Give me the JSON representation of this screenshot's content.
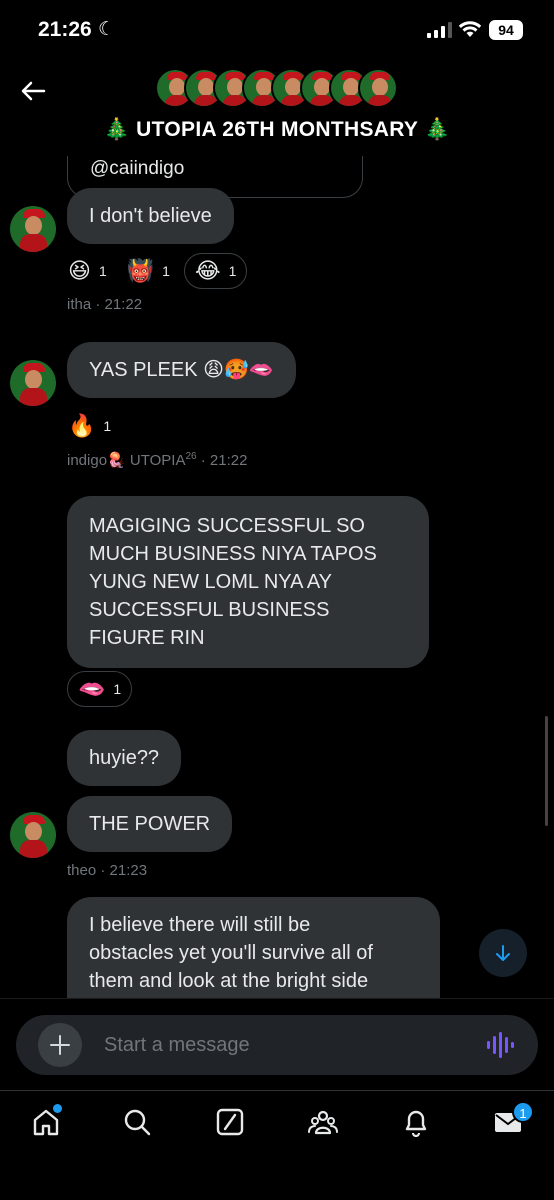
{
  "status_bar": {
    "time": "21:26",
    "battery": "94"
  },
  "header": {
    "title": "🎄 UTOPIA 26TH MONTHSARY 🎄",
    "group_avatar_count": 8
  },
  "quoted_message": {
    "text": "@caiindigo"
  },
  "messages": [
    {
      "id": "msg1",
      "text": "I don't believe",
      "reactions": [
        {
          "emoji": "😆",
          "count": "1"
        },
        {
          "emoji": "👹",
          "count": "1"
        },
        {
          "emoji": "😂",
          "count": "1"
        }
      ],
      "meta": "itha · 21:22"
    },
    {
      "id": "msg2",
      "text": "YAS PLEEK 😩🥵🫦",
      "reactions": [
        {
          "emoji": "🔥",
          "count": "1"
        }
      ],
      "meta_name": "indigo🪼 UTOPIA",
      "meta_sup": "26",
      "meta_time": " · 21:22"
    },
    {
      "id": "msg3",
      "lines": [
        "MAGIGING SUCCESSFUL SO",
        "MUCH BUSINESS NIYA TAPOS",
        "YUNG NEW LOML NYA AY",
        "SUCCESSFUL BUSINESS",
        "FIGURE RIN"
      ],
      "reactions": [
        {
          "emoji": "🫦",
          "count": "1"
        }
      ]
    },
    {
      "id": "msg4",
      "text": "huyie??"
    },
    {
      "id": "msg5",
      "text": "THE POWER",
      "meta": "theo · 21:23"
    },
    {
      "id": "msg6",
      "lines": [
        "I believe there will still be",
        "obstacles yet you'll survive all of",
        "them and look at the bright side"
      ]
    }
  ],
  "composer": {
    "placeholder": "Start a message"
  },
  "bottom_nav": {
    "items": [
      "home-icon",
      "search-icon",
      "grok-icon",
      "communities-icon",
      "notifications-icon",
      "messages-icon"
    ],
    "messages_badge": "1"
  },
  "colors": {
    "background": "#000000",
    "bubble": "#2f3336",
    "accent": "#1d9bf0",
    "muted_text": "#71767b",
    "voice_icon": "#7856ff"
  }
}
